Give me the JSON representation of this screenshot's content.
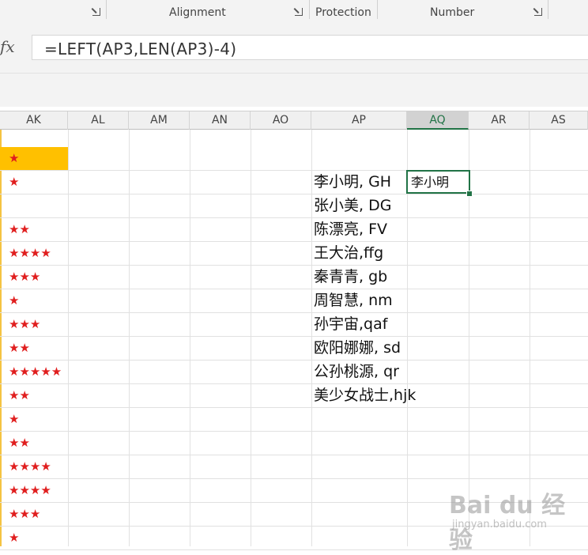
{
  "ribbon": {
    "groups": [
      "Alignment",
      "Protection",
      "Number"
    ]
  },
  "formula_bar": {
    "fx_label": "fx",
    "formula": "=LEFT(AP3,LEN(AP3)-4)"
  },
  "columns": [
    "AK",
    "AL",
    "AM",
    "AN",
    "AO",
    "AP",
    "AQ",
    "AR",
    "AS"
  ],
  "selected_column": "AQ",
  "colors": {
    "accent": "#217346",
    "highlight_fill": "#ffc000",
    "star_color": "#e01e1e"
  },
  "rows": [
    {
      "ak": "★",
      "ap": "",
      "aq": ""
    },
    {
      "ak": "★",
      "ap": "李小明, GH",
      "aq": "李小明"
    },
    {
      "ak": "",
      "ap": "张小美, DG",
      "aq": ""
    },
    {
      "ak": "★★",
      "ap": "陈漂亮, FV",
      "aq": ""
    },
    {
      "ak": "★★★★",
      "ap": "王大治,ffg",
      "aq": ""
    },
    {
      "ak": "★★★",
      "ap": "秦青青, gb",
      "aq": ""
    },
    {
      "ak": "★",
      "ap": "周智慧, nm",
      "aq": ""
    },
    {
      "ak": "★★★",
      "ap": "孙宇宙,qaf",
      "aq": ""
    },
    {
      "ak": "★★",
      "ap": "欧阳娜娜, sd",
      "aq": ""
    },
    {
      "ak": "★★★★★",
      "ap": "公孙桃源, qr",
      "aq": ""
    },
    {
      "ak": "★★",
      "ap": "美少女战士,hjk",
      "aq": ""
    },
    {
      "ak": "★",
      "ap": "",
      "aq": ""
    },
    {
      "ak": "★★",
      "ap": "",
      "aq": ""
    },
    {
      "ak": "★★★★",
      "ap": "",
      "aq": ""
    },
    {
      "ak": "★★★★",
      "ap": "",
      "aq": ""
    },
    {
      "ak": "★★★",
      "ap": "",
      "aq": ""
    },
    {
      "ak": "★",
      "ap": "",
      "aq": ""
    }
  ],
  "watermark": {
    "main": "Bai du 经验",
    "sub": "jingyan.baidu.com"
  }
}
